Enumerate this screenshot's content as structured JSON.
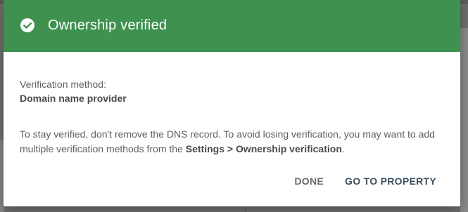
{
  "dialog": {
    "title": "Ownership verified",
    "header_color": "#3f9150",
    "method_label": "Verification method:",
    "method_value": "Domain name provider",
    "info_text_part1": "To stay verified, don't remove the DNS record. To avoid losing verification, you may want to add multiple verification methods from the ",
    "info_text_bold": "Settings > Ownership verification",
    "info_text_part2": ".",
    "actions": {
      "done_label": "DONE",
      "go_label": "GO TO PROPERTY"
    },
    "icon": "check-circle-icon"
  }
}
